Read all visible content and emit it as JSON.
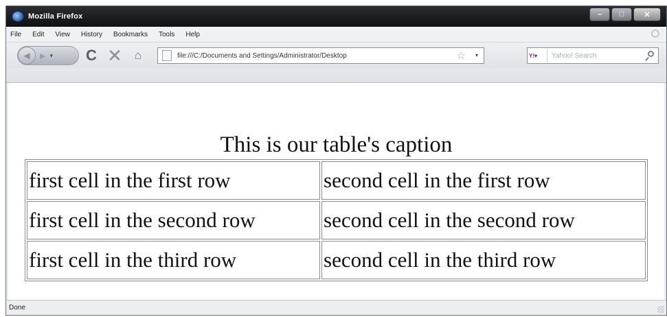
{
  "window": {
    "title": "Mozilla Firefox",
    "controls": {
      "minimize": "–",
      "maximize": "□",
      "close": "✕"
    }
  },
  "menu": [
    "File",
    "Edit",
    "View",
    "History",
    "Bookmarks",
    "Tools",
    "Help"
  ],
  "toolbar": {
    "url": "file:///C:/Documents and Settings/Administrator/Desktop",
    "search_placeholder": "Yahoo! Search",
    "search_engine_label": "Y!"
  },
  "page": {
    "caption": "This is our table's caption",
    "rows": [
      [
        "first cell in the first row",
        "second cell in the first row"
      ],
      [
        "first cell in the second row",
        "second cell in the second row"
      ],
      [
        "first cell in the third row",
        "second cell in the third row"
      ]
    ]
  },
  "status": {
    "text": "Done"
  },
  "colors": {
    "titlebar": "#0e1012",
    "chrome": "#e9ecef",
    "content_bg": "#ffffff"
  },
  "icons": [
    "firefox-logo-icon",
    "back-icon",
    "forward-icon",
    "reload-icon",
    "stop-icon",
    "home-icon",
    "page-icon",
    "bookmark-star-icon",
    "search-icon"
  ]
}
